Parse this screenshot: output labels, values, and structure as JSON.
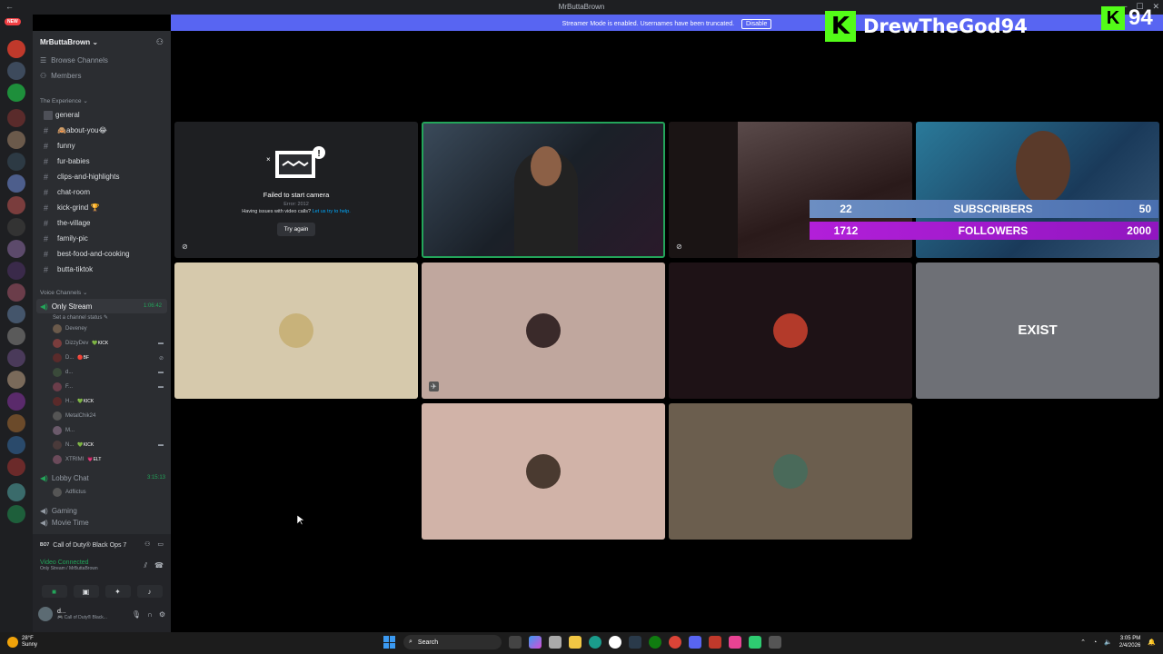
{
  "titlebar": {
    "title": "MrButtaBrown",
    "back": "←"
  },
  "banner": {
    "text": "Streamer Mode is enabled. Usernames have been truncated.",
    "button": "Disable"
  },
  "kick_overlay": {
    "logo": "K",
    "name": "DrewTheGod94",
    "logo_small": "K",
    "number": "94"
  },
  "server_rail": {
    "new_badge": "NEW"
  },
  "sidebar": {
    "server_name": "MrButtaBrown ⌄",
    "nav": [
      {
        "label": "Browse Channels"
      },
      {
        "label": "Members"
      }
    ],
    "text_category": "The Experience ⌄",
    "text_channels": [
      {
        "label": "general"
      },
      {
        "label": "🙈about-you😂"
      },
      {
        "label": "funny"
      },
      {
        "label": "fur-babies"
      },
      {
        "label": "clips-and-highlights"
      },
      {
        "label": "chat-room"
      },
      {
        "label": "kick-grind 🏆"
      },
      {
        "label": "the-village"
      },
      {
        "label": "family-pic"
      },
      {
        "label": "best-food-and-cooking"
      },
      {
        "label": "butta-tiktok"
      }
    ],
    "voice_category": "Voice Channels ⌄",
    "active_voice": {
      "label": "Only Stream",
      "timer": "1:06:42",
      "status": "Set a channel status ✎"
    },
    "members": [
      {
        "name": "Deveney",
        "tag": ""
      },
      {
        "name": "DizzyDev",
        "tag": "💚KICK"
      },
      {
        "name": "D...",
        "tag": "🔴BF"
      },
      {
        "name": "d...",
        "tag": ""
      },
      {
        "name": "F...",
        "tag": ""
      },
      {
        "name": "H...",
        "tag": "💚KICK"
      },
      {
        "name": "MetalChik24",
        "tag": ""
      },
      {
        "name": "M...",
        "tag": ""
      },
      {
        "name": "N...",
        "tag": "💚KICK"
      },
      {
        "name": "XTRIMI",
        "tag": "💗ELT"
      }
    ],
    "lobby": {
      "label": "Lobby Chat",
      "timer": "3:15:13"
    },
    "lobby_member": "Adflictus",
    "gaming": "Gaming",
    "movie": "Movie Time"
  },
  "voice_panel": {
    "game": "Call of Duty® Black Ops 7",
    "status": "Video Connected",
    "sub": "Only Stream / MrButtaBrown",
    "user_name": "d...",
    "user_sub": "🎮 Call of Duty® Black..."
  },
  "camera_fail": {
    "title": "Failed to start camera",
    "error": "Error: 2012",
    "help": "Having issues with video calls? ",
    "help_link": "Let us try to help.",
    "button": "Try again"
  },
  "stats": {
    "subscribers": {
      "n1": "22",
      "label": "SUBSCRIBERS",
      "n2": "50"
    },
    "followers": {
      "n1": "1712",
      "label": "FOLLOWERS",
      "n2": "2000"
    }
  },
  "exist_text": "EXIST",
  "taskbar": {
    "weather_temp": "28°F",
    "weather_desc": "Sunny",
    "search": "Search",
    "time": "3:05 PM",
    "date": "2/4/2026"
  },
  "colors": {
    "accent": "#5865f2",
    "kick_green": "#53fc18",
    "connected_green": "#23a55a"
  }
}
